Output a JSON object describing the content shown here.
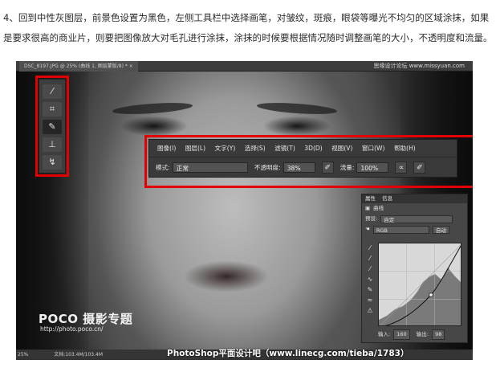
{
  "intro": {
    "line1": "4、回到中性灰图层，前景色设置为黑色，左侧工具栏中选择画笔，对皱纹，斑痕，眼袋等曝光不均匀的区域涂抹，如果",
    "line2": "是要求很高的商业片，则要把图像放大对毛孔进行涂抹，涂抹的时候要根据情况随时调整画笔的大小，不透明度和流量。"
  },
  "document": {
    "tab_title": "DSC_8197.JPG @ 25% (曲线 1, 图层蒙版/8) * ×",
    "watermark_top": "思缘设计论坛 www.missyuan.com"
  },
  "toolbox": {
    "tools": [
      {
        "icon": "eyedropper-icon",
        "glyph": "⁄"
      },
      {
        "icon": "patch-icon",
        "glyph": "⌗"
      },
      {
        "icon": "brush-icon",
        "glyph": "✎"
      },
      {
        "icon": "stamp-icon",
        "glyph": "⊥"
      },
      {
        "icon": "history-brush-icon",
        "glyph": "↯"
      }
    ]
  },
  "menubar": {
    "items": [
      "图像(I)",
      "图层(L)",
      "文字(Y)",
      "选择(S)",
      "滤镜(T)",
      "3D(D)",
      "视图(V)",
      "窗口(W)",
      "帮助(H)"
    ]
  },
  "options": {
    "mode_label": "模式:",
    "mode_value": "正常",
    "opacity_label": "不透明度:",
    "opacity_value": "38%",
    "flow_label": "流量:",
    "flow_value": "100%"
  },
  "properties": {
    "tabs": [
      "属性",
      "信息"
    ],
    "layer_name": "曲线",
    "preset_label": "预设:",
    "preset_value": "自定",
    "channel_value": "RGB",
    "auto_label": "自动",
    "input_label": "输入:",
    "input_value": "160",
    "output_label": "输出:",
    "output_value": "98"
  },
  "photo": {
    "logo_text": "POCO 摄影专题",
    "logo_url": "http://photo.poco.cn/"
  },
  "statusbar": {
    "zoom": "25%",
    "doc_info": "文档:103.4M/103.4M"
  },
  "credit": "PhotoShop平面设计吧（www.linecg.com/tieba/1783）"
}
